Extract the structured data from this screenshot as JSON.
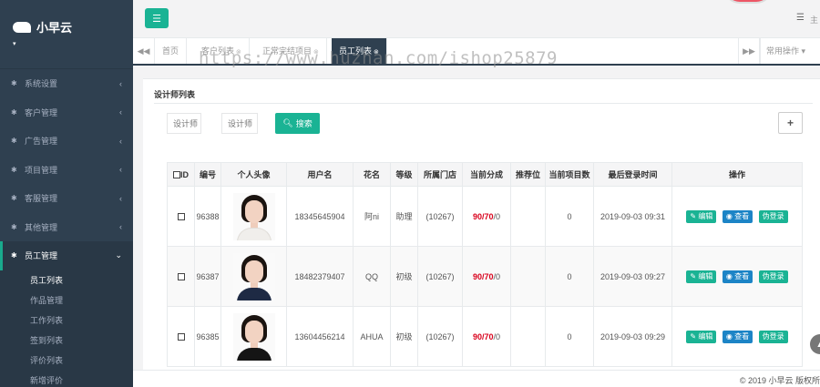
{
  "brand": {
    "name": "小早云",
    "caret": "▾"
  },
  "sidebar": {
    "items": [
      {
        "label": "系统设置"
      },
      {
        "label": "客户管理"
      },
      {
        "label": "广告管理"
      },
      {
        "label": "项目管理"
      },
      {
        "label": "客服管理"
      },
      {
        "label": "其他管理"
      },
      {
        "label": "员工管理"
      }
    ],
    "sub_items": [
      {
        "label": "员工列表"
      },
      {
        "label": "作品管理"
      },
      {
        "label": "工作列表"
      },
      {
        "label": "签到列表"
      },
      {
        "label": "评价列表"
      },
      {
        "label": "新增评价"
      }
    ]
  },
  "topbar": {
    "right_text": "主"
  },
  "tabs": [
    {
      "label": "首页"
    },
    {
      "label": "客户列表"
    },
    {
      "label": "正常完结项目"
    },
    {
      "label": "员工列表"
    }
  ],
  "common_ops": "常用操作",
  "watermark": "https://www.huzhan.com/ishop25879",
  "page": {
    "title": "设计师列表",
    "filter1_placeholder": "设计师",
    "filter2_placeholder": "设计师",
    "search_label": "搜索",
    "add_label": "+"
  },
  "table": {
    "headers": [
      "ID",
      "编号",
      "个人头像",
      "用户名",
      "花名",
      "等级",
      "所属门店",
      "当前分成",
      "推荐位",
      "当前项目数",
      "最后登录时间",
      "操作"
    ],
    "rows": [
      {
        "id": "96388",
        "username": "18345645904",
        "nickname": "阿ni",
        "level": "助理",
        "store": "(10267)",
        "share_a": "90/70",
        "share_b": "/0",
        "recommend": "",
        "projects": "0",
        "last_login": "2019-09-03 09:31"
      },
      {
        "id": "96387",
        "username": "18482379407",
        "nickname": "QQ",
        "level": "初级",
        "store": "(10267)",
        "share_a": "90/70",
        "share_b": "/0",
        "recommend": "",
        "projects": "0",
        "last_login": "2019-09-03 09:27"
      },
      {
        "id": "96385",
        "username": "13604456214",
        "nickname": "AHUA",
        "level": "初级",
        "store": "(10267)",
        "share_a": "90/70",
        "share_b": "/0",
        "recommend": "",
        "projects": "0",
        "last_login": "2019-09-03 09:29"
      }
    ],
    "actions": {
      "edit": "编辑",
      "view": "查看",
      "fake_login": "伪登录"
    }
  },
  "footer": "© 2019 小早云 版权所",
  "colors": {
    "sidebar": "#2f4050",
    "accent": "#1ab394",
    "blue": "#1c84c6",
    "red": "#d9001b"
  }
}
